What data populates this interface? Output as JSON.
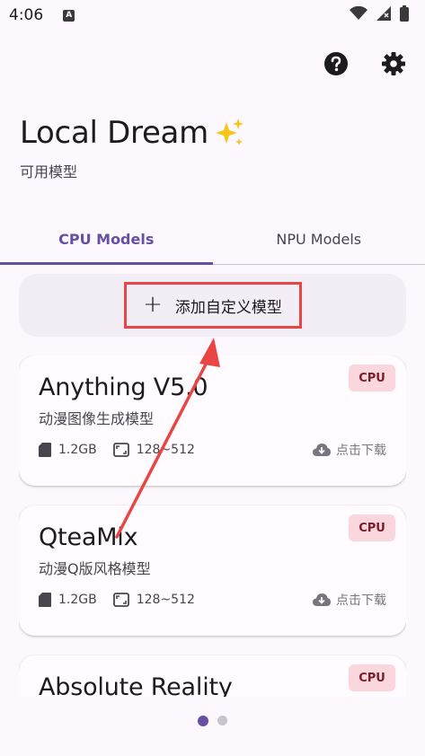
{
  "status_bar": {
    "time": "4:06",
    "notification_letter": "A"
  },
  "header": {
    "title": "Local Dream",
    "title_emoji": "✨",
    "subtitle": "可用模型"
  },
  "tabs": [
    {
      "label": "CPU Models",
      "active": true
    },
    {
      "label": "NPU Models",
      "active": false
    }
  ],
  "add_button": {
    "label": "添加自定义模型",
    "icon": "plus-icon"
  },
  "models": [
    {
      "name": "Anything V5.0",
      "desc": "动漫图像生成模型",
      "size": "1.2GB",
      "resolution": "128~512",
      "badge": "CPU",
      "download_label": "点击下载"
    },
    {
      "name": "QteaMix",
      "desc": "动漫Q版风格模型",
      "size": "1.2GB",
      "resolution": "128~512",
      "badge": "CPU",
      "download_label": "点击下载"
    },
    {
      "name": "Absolute Reality",
      "desc": "",
      "size": "",
      "resolution": "",
      "badge": "CPU",
      "download_label": ""
    }
  ],
  "pager": {
    "pages": 2,
    "active": 1
  },
  "colors": {
    "accent": "#6750a4",
    "highlight_box": "#e94545",
    "badge_bg": "#f9d7dc",
    "background": "#fdf7fe"
  },
  "icons": [
    "wifi-icon",
    "signal-icon",
    "battery-icon",
    "help-icon",
    "gear-icon",
    "sd-card-icon",
    "aspect-ratio-icon",
    "cloud-download-icon",
    "annotation-arrow"
  ]
}
